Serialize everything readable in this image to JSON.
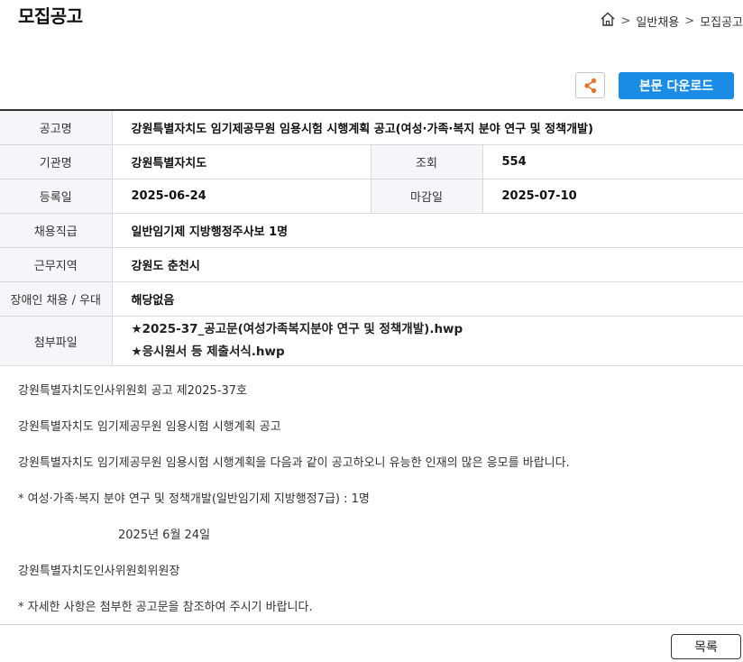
{
  "header": {
    "title": "모집공고",
    "breadcrumb": [
      ">",
      "일반채용",
      ">",
      "모집공고"
    ]
  },
  "toolbar": {
    "share_icon": "share-icon",
    "download_label": "본문 다운로드",
    "accent_color": "#1a8ce6"
  },
  "info": {
    "title_label": "공고명",
    "title_value": "강원특별자치도 임기제공무원 임용시험 시행계획 공고(여성·가족·복지 분야 연구 및 정책개발)",
    "org_label": "기관명",
    "org_value": "강원특별자치도",
    "views_label": "조회",
    "views_value": "554",
    "reg_label": "등록일",
    "reg_value": "2025-06-24",
    "deadline_label": "마감일",
    "deadline_value": "2025-07-10",
    "grade_label": "채용직급",
    "grade_value": "일반임기제 지방행정주사보 1명",
    "region_label": "근무지역",
    "region_value": "강원도 춘천시",
    "disability_label": "장애인 채용 / 우대",
    "disability_value": "해당없음",
    "files_label": "첨부파일",
    "files": [
      "★2025-37_공고문(여성가족복지분야 연구 및 정책개발).hwp",
      "★응시원서 등 제출서식.hwp"
    ]
  },
  "body": {
    "lines": [
      "강원특별자치도인사위원회 공고 제2025-37호",
      "강원특별자치도 임기제공무원 임용시험 시행계획 공고",
      "강원특별자치도 임기제공무원 임용시험 시행계획을 다음과 같이 공고하오니 유능한 인재의 많은 응모를 바랍니다.",
      "* 여성·가족·복지 분야 연구 및 정책개발(일반임기제 지방행정7급) : 1명",
      "2025년 6월 24일",
      "강원특별자치도인사위원회위원장",
      "* 자세한 사항은 첨부한 공고문을 참조하여 주시기 바랍니다."
    ]
  },
  "footer": {
    "list_label": "목록"
  }
}
